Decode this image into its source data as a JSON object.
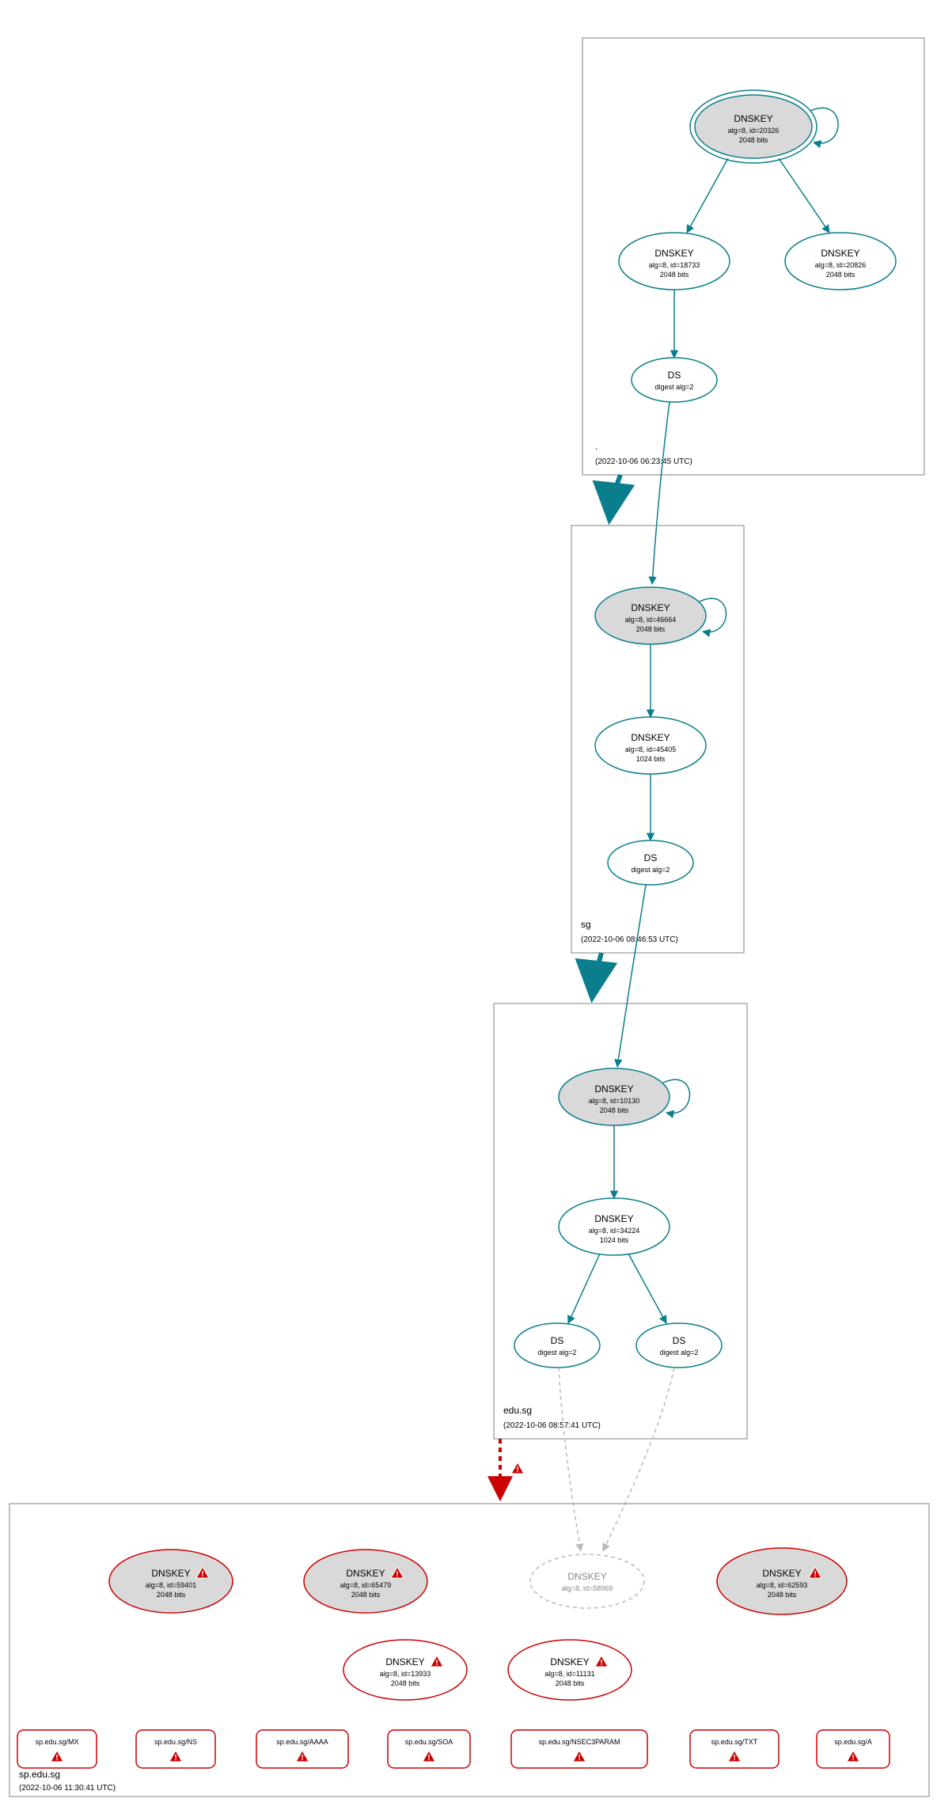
{
  "zones": {
    "root": {
      "name": ".",
      "timestamp": "(2022-10-06 06:23:45 UTC)"
    },
    "sg": {
      "name": "sg",
      "timestamp": "(2022-10-06 08:46:53 UTC)"
    },
    "edu_sg": {
      "name": "edu.sg",
      "timestamp": "(2022-10-06 08:57:41 UTC)"
    },
    "sp_edu_sg": {
      "name": "sp.edu.sg",
      "timestamp": "(2022-10-06 11:30:41 UTC)"
    }
  },
  "nodes": {
    "root_ksk": {
      "title": "DNSKEY",
      "l1": "alg=8, id=20326",
      "l2": "2048 bits"
    },
    "root_zsk1": {
      "title": "DNSKEY",
      "l1": "alg=8, id=18733",
      "l2": "2048 bits"
    },
    "root_zsk2": {
      "title": "DNSKEY",
      "l1": "alg=8, id=20826",
      "l2": "2048 bits"
    },
    "root_ds": {
      "title": "DS",
      "l1": "digest alg=2"
    },
    "sg_ksk": {
      "title": "DNSKEY",
      "l1": "alg=8, id=46664",
      "l2": "2048 bits"
    },
    "sg_zsk": {
      "title": "DNSKEY",
      "l1": "alg=8, id=45405",
      "l2": "1024 bits"
    },
    "sg_ds": {
      "title": "DS",
      "l1": "digest alg=2"
    },
    "edu_ksk": {
      "title": "DNSKEY",
      "l1": "alg=8, id=10130",
      "l2": "2048 bits"
    },
    "edu_zsk": {
      "title": "DNSKEY",
      "l1": "alg=8, id=34224",
      "l2": "1024 bits"
    },
    "edu_ds1": {
      "title": "DS",
      "l1": "digest alg=2"
    },
    "edu_ds2": {
      "title": "DS",
      "l1": "digest alg=2"
    },
    "sp_k1": {
      "title": "DNSKEY",
      "l1": "alg=8, id=59401",
      "l2": "2048 bits"
    },
    "sp_k2": {
      "title": "DNSKEY",
      "l1": "alg=8, id=65479",
      "l2": "2048 bits"
    },
    "sp_k3": {
      "title": "DNSKEY",
      "l1": "alg=8, id=58969"
    },
    "sp_k4": {
      "title": "DNSKEY",
      "l1": "alg=8, id=62593",
      "l2": "2048 bits"
    },
    "sp_k5": {
      "title": "DNSKEY",
      "l1": "alg=8, id=13933",
      "l2": "2048 bits"
    },
    "sp_k6": {
      "title": "DNSKEY",
      "l1": "alg=8, id=11131",
      "l2": "2048 bits"
    }
  },
  "rrsets": {
    "mx": "sp.edu.sg/MX",
    "ns": "sp.edu.sg/NS",
    "aaaa": "sp.edu.sg/AAAA",
    "soa": "sp.edu.sg/SOA",
    "nsec3": "sp.edu.sg/NSEC3PARAM",
    "txt": "sp.edu.sg/TXT",
    "a": "sp.edu.sg/A"
  }
}
